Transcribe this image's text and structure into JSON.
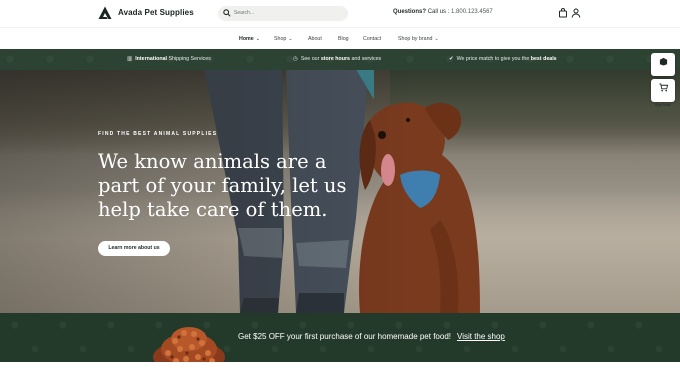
{
  "header": {
    "brand": "Avada Pet Supplies",
    "search_placeholder": "Search...",
    "questions_label": "Questions?",
    "call_label": "Call us :",
    "phone": "1.800.123.4567"
  },
  "nav": {
    "items": [
      "Home",
      "Shop",
      "About",
      "Blog",
      "Contact",
      "Shop by brand"
    ]
  },
  "topbar": {
    "shipping_bold": "International",
    "shipping_rest": " Shipping Services",
    "hours_pre": "See our ",
    "hours_bold": "store hours",
    "hours_post": " and services",
    "price_pre": "We price match to give you the ",
    "price_bold": "best deals"
  },
  "hero": {
    "kicker": "FIND THE BEST ANIMAL SUPPLIES",
    "headline": "We know animals are a part of your family, let us help take care of them.",
    "cta": "Learn more about us"
  },
  "widgets": {
    "demos": "Demos",
    "buy_now": "Buy Now"
  },
  "promo": {
    "text": "Get $25 OFF your first purchase of our homemade pet food!",
    "link": "Visit the shop"
  },
  "colors": {
    "dark_green": "#2c4232",
    "promo_green": "#233a2b"
  }
}
